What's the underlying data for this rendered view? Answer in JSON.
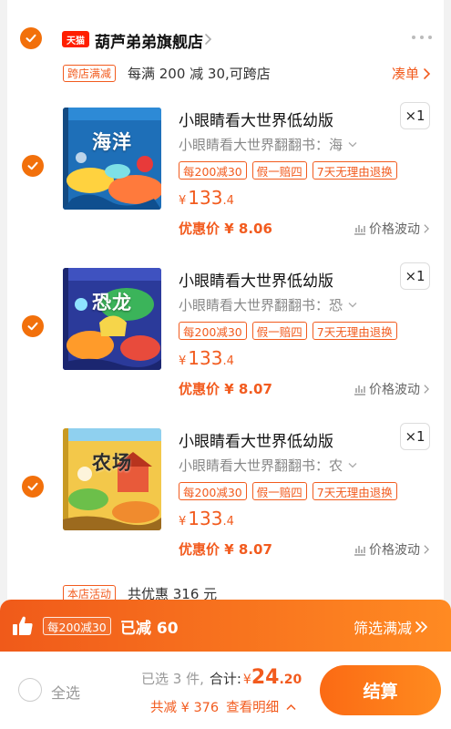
{
  "shop": {
    "badge": "天猫",
    "name": "葫芦弟弟旗舰店"
  },
  "promo": {
    "tag": "跨店满减",
    "text": "每满 200 减 30,可跨店",
    "coudan": "凑单"
  },
  "items": [
    {
      "cover_text": "海洋",
      "title": "小眼睛看大世界低幼版",
      "qty": "×1",
      "sku": "小眼睛看大世界翻翻书：海",
      "tags": [
        "每200减30",
        "假一赔四",
        "7天无理由退换"
      ],
      "price_cur": "¥",
      "price_int": "133",
      "price_dec": ".4",
      "discount": "优惠价 ¥ 8.06",
      "fluct": "价格波动"
    },
    {
      "cover_text": "恐龙",
      "title": "小眼睛看大世界低幼版",
      "qty": "×1",
      "sku": "小眼睛看大世界翻翻书：恐",
      "tags": [
        "每200减30",
        "假一赔四",
        "7天无理由退换"
      ],
      "price_cur": "¥",
      "price_int": "133",
      "price_dec": ".4",
      "discount": "优惠价 ¥ 8.07",
      "fluct": "价格波动"
    },
    {
      "cover_text": "农场",
      "title": "小眼睛看大世界低幼版",
      "qty": "×1",
      "sku": "小眼睛看大世界翻翻书：农",
      "tags": [
        "每200减30",
        "假一赔四",
        "7天无理由退换"
      ],
      "price_cur": "¥",
      "price_int": "133",
      "price_dec": ".4",
      "discount": "优惠价 ¥ 8.07",
      "fluct": "价格波动"
    }
  ],
  "store_activity": {
    "tag": "本店活动",
    "text": "共优惠 316 元"
  },
  "banner": {
    "tag": "每200减30",
    "saved": "已减 60",
    "filter": "筛选满减"
  },
  "bottom": {
    "select_all": "全选",
    "count": "已选 3 件,",
    "total_label": "合计:",
    "total_cur": "¥",
    "total_int": "24",
    "total_dec": ".20",
    "saved": "共减 ¥ 376",
    "detail": "查看明细",
    "checkout": "结算"
  },
  "colors": {
    "accent": "#f25b1e",
    "check": "#f2700b",
    "tmall": "#ff1f00"
  }
}
